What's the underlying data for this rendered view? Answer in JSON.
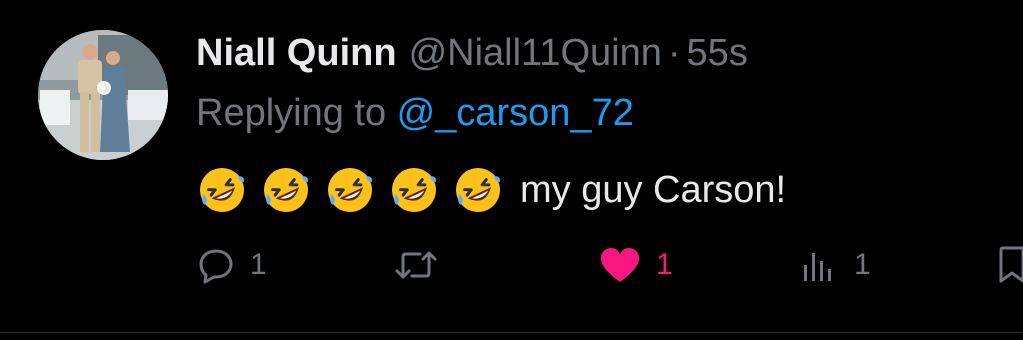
{
  "tweet": {
    "author_name": "Niall Quinn",
    "author_handle": "@Niall11Quinn",
    "separator": "·",
    "timestamp": "55s",
    "replying_prefix": "Replying to ",
    "replying_to": "@_carson_72",
    "emojis": [
      "rolling-on-floor-laughing",
      "rolling-on-floor-laughing",
      "rolling-on-floor-laughing",
      "rolling-on-floor-laughing",
      "rolling-on-floor-laughing"
    ],
    "text": "my guy Carson!"
  },
  "actions": {
    "replies": "1",
    "retweets": "",
    "likes": "1",
    "views": "1"
  },
  "colors": {
    "background": "#000000",
    "primary_text": "#e7e9ea",
    "secondary_text": "#71767b",
    "link": "#1d9bf0",
    "like_active": "#f91880"
  },
  "icons": {
    "reply": "reply-icon",
    "retweet": "retweet-icon",
    "like": "heart-icon",
    "views": "views-icon",
    "bookmark": "bookmark-icon"
  }
}
